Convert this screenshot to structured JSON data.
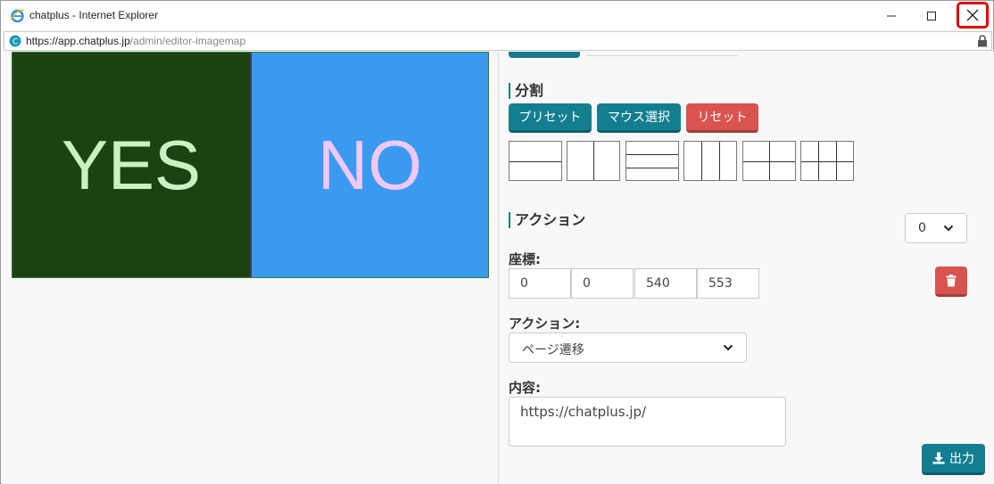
{
  "window": {
    "title": "chatplus - Internet Explorer",
    "url_host": "https://app.chatplus.jp",
    "url_path": "/admin/editor-imagemap"
  },
  "imagemap": {
    "areas": [
      {
        "label": "YES",
        "bg": "#1b4312",
        "text_color": "#c9f2c0"
      },
      {
        "label": "NO",
        "bg": "#3a9af0",
        "text_color": "#f0c8f5"
      }
    ]
  },
  "split": {
    "heading": "分割",
    "buttons": {
      "preset": "プリセット",
      "mouse": "マウス選択",
      "reset": "リセット"
    },
    "layouts": [
      "2-rows",
      "2-columns",
      "3-rows",
      "3-columns",
      "2x2-grid",
      "2x3-grid"
    ]
  },
  "action": {
    "heading": "アクション",
    "area_index": "0",
    "coord_label": "座標:",
    "coords": [
      "0",
      "0",
      "540",
      "553"
    ],
    "action_label": "アクション:",
    "action_value": "ページ遷移",
    "content_label": "内容:",
    "content_value": "https://chatplus.jp/"
  },
  "output_label": "出力",
  "colors": {
    "accent": "#137e8f",
    "danger": "#d9534f",
    "highlight": "#e00000"
  }
}
